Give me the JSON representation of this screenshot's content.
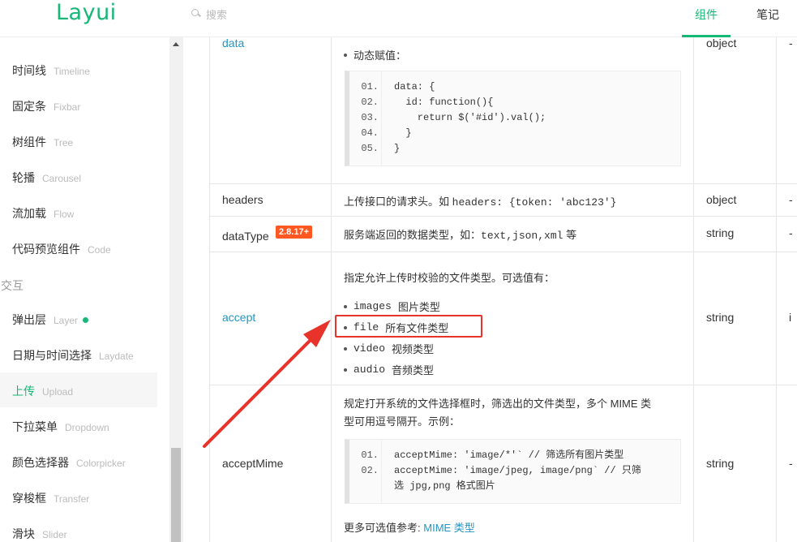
{
  "header": {
    "logo": "Layui",
    "search_placeholder": "搜索",
    "tabs": [
      {
        "label": "组件",
        "active": true
      },
      {
        "label": "笔记",
        "active": false
      }
    ]
  },
  "sidebar": {
    "items": [
      {
        "cn": "时间线",
        "en": "Timeline"
      },
      {
        "cn": "固定条",
        "en": "Fixbar"
      },
      {
        "cn": "树组件",
        "en": "Tree"
      },
      {
        "cn": "轮播",
        "en": "Carousel"
      },
      {
        "cn": "流加载",
        "en": "Flow"
      },
      {
        "cn": "代码预览组件",
        "en": "Code"
      },
      {
        "cn": "弹出层",
        "en": "Layer"
      },
      {
        "cn": "日期与时间选择",
        "en": "Laydate"
      },
      {
        "cn": "上传",
        "en": "Upload"
      },
      {
        "cn": "下拉菜单",
        "en": "Dropdown"
      },
      {
        "cn": "颜色选择器",
        "en": "Colorpicker"
      },
      {
        "cn": "穿梭框",
        "en": "Transfer"
      },
      {
        "cn": "滑块",
        "en": "Slider"
      }
    ],
    "group_label": "交互",
    "active_item": "上传"
  },
  "table": {
    "rows": {
      "data": {
        "name": "data",
        "type": "object",
        "dash": "-",
        "bullet": "动态赋值：",
        "code": [
          {
            "n": "01.",
            "t": "data: {"
          },
          {
            "n": "02.",
            "t": "  id: function(){"
          },
          {
            "n": "03.",
            "t": "    return $('#id').val();"
          },
          {
            "n": "04.",
            "t": "  }"
          },
          {
            "n": "05.",
            "t": "}"
          }
        ]
      },
      "headers": {
        "name": "headers",
        "type": "object",
        "dash": "-",
        "desc_prefix": "上传接口的请求头。如",
        "desc_code": "headers: {token: 'abc123'}"
      },
      "dataType": {
        "name": "dataType",
        "badge": "2.8.17+",
        "type": "string",
        "dash": "-",
        "desc_prefix": "服务端返回的数据类型，如：",
        "desc_code": "text,json,xml",
        "desc_suffix": "等"
      },
      "accept": {
        "name": "accept",
        "type": "string",
        "dash": "i",
        "desc": "指定允许上传时校验的文件类型。可选值有：",
        "options": [
          {
            "code": "images",
            "label": "图片类型"
          },
          {
            "code": "file",
            "label": "所有文件类型"
          },
          {
            "code": "video",
            "label": "视频类型"
          },
          {
            "code": "audio",
            "label": "音频类型"
          }
        ]
      },
      "acceptMime": {
        "name": "acceptMime",
        "type": "string",
        "dash": "-",
        "desc_line1": "规定打开系统的文件选择框时，筛选出的文件类型，多个 MIME 类",
        "desc_line2": "型可用逗号隔开。示例：",
        "code": [
          {
            "n": "01.",
            "t": "acceptMime: 'image/*'` // 筛选所有图片类型"
          },
          {
            "n": "02.",
            "t": "acceptMime: 'image/jpeg, image/png` // 只筛"
          },
          {
            "n": "",
            "t": "选 jpg,png 格式图片"
          }
        ],
        "more_prefix": "更多可选值参考:",
        "more_link": "MIME 类型"
      }
    }
  },
  "colors": {
    "brand": "#16b777",
    "link": "#2196c4",
    "badge": "#ff5722",
    "annotation": "#e8332a"
  }
}
